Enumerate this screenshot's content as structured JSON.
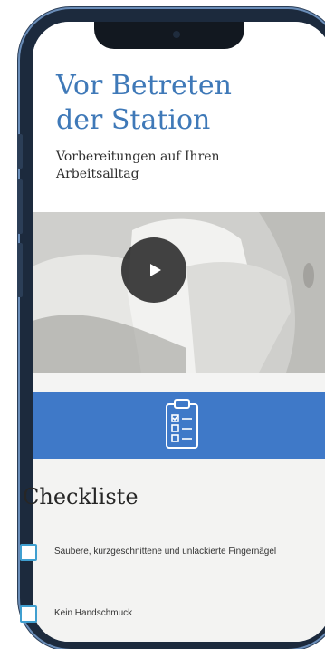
{
  "header": {
    "title": "Vor Betreten\nder Station",
    "subtitle": "Vorbereitungen auf Ihren\nArbeitsalltag"
  },
  "video": {
    "play_icon": "play-icon"
  },
  "banner": {
    "icon": "clipboard-checklist-icon",
    "color": "#3f79c8"
  },
  "checklist": {
    "title": "Checkliste",
    "items": [
      {
        "label": "Saubere, kurzgeschnittene und unlackierte Fingernägel",
        "checked": false
      },
      {
        "label": "Kein Handschmuck",
        "checked": false
      }
    ]
  },
  "colors": {
    "accent": "#3f79b8",
    "checkbox": "#3f9fd0"
  }
}
